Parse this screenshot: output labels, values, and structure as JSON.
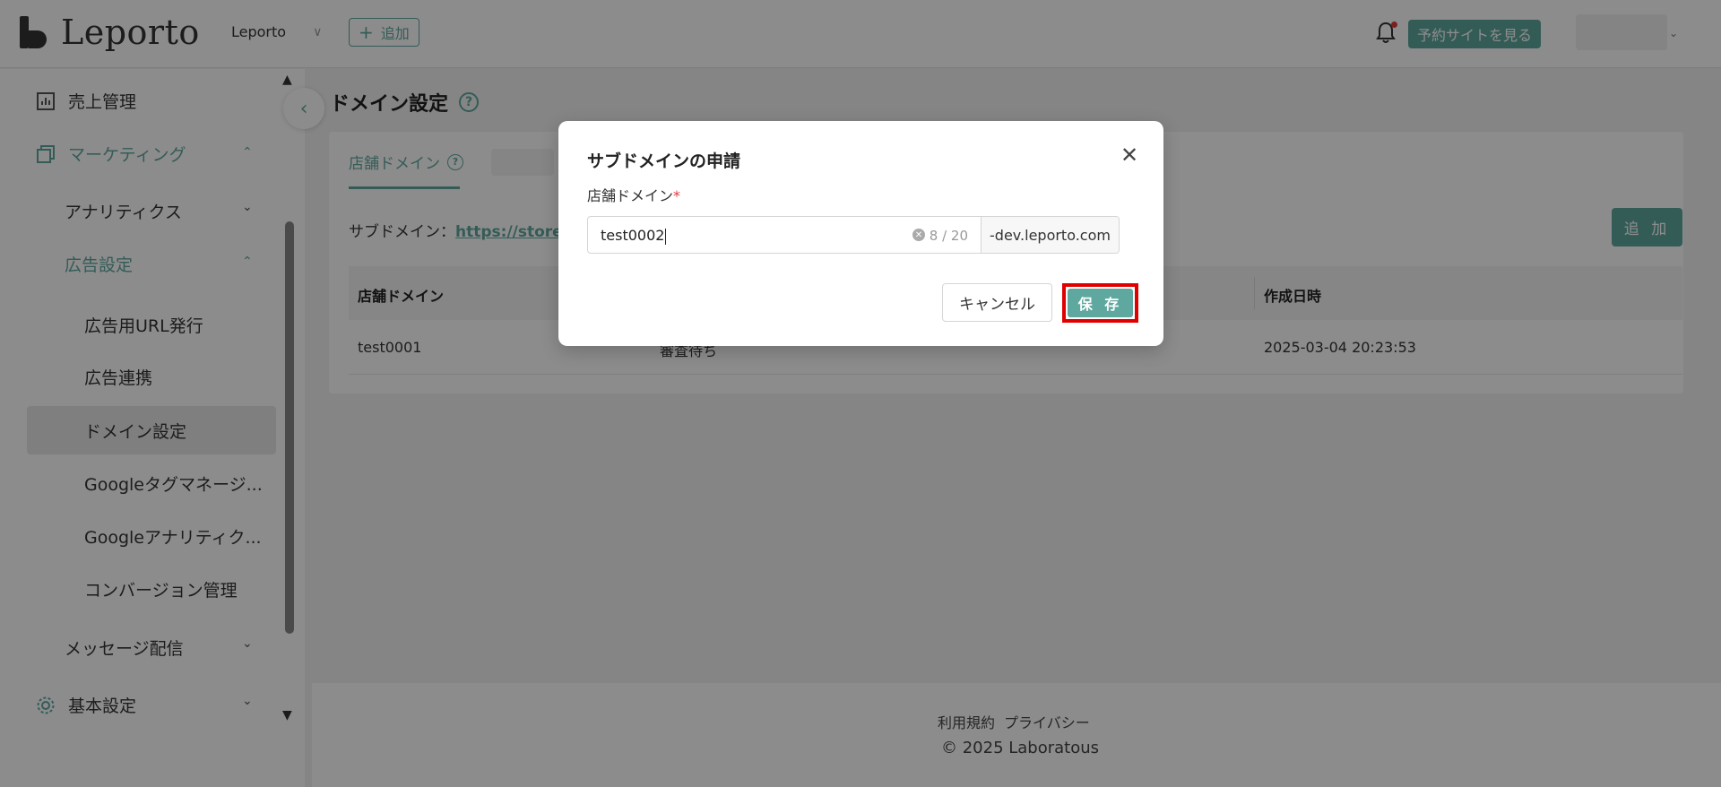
{
  "header": {
    "logo_text": "Leporto",
    "store_name": "Leporto",
    "add_label": "追加",
    "view_site_label": "予約サイトを見る"
  },
  "sidebar": {
    "items": [
      {
        "label": "売上管理"
      },
      {
        "label": "マーケティング"
      },
      {
        "label": "アナリティクス"
      },
      {
        "label": "広告設定"
      },
      {
        "label": "広告用URL発行"
      },
      {
        "label": "広告連携"
      },
      {
        "label": "ドメイン設定"
      },
      {
        "label": "Googleタグマネージ..."
      },
      {
        "label": "Googleアナリティク..."
      },
      {
        "label": "コンバージョン管理"
      },
      {
        "label": "メッセージ配信"
      },
      {
        "label": "基本設定"
      }
    ]
  },
  "main": {
    "page_title": "ドメイン設定",
    "tabs": [
      {
        "label": "店舗ドメイン"
      }
    ],
    "subdomain_label": "サブドメイン：",
    "subdomain_link": "https://store51-c",
    "add_label": "追 加",
    "table": {
      "columns": [
        "店舗ドメイン",
        "作成日時"
      ],
      "rows": [
        {
          "domain": "test0001",
          "status": "審査待ち",
          "created": "2025-03-04 20:23:53"
        }
      ]
    }
  },
  "footer": {
    "links": [
      "利用規約",
      "プライバシー"
    ],
    "copyright": "© 2025 Laboratous"
  },
  "modal": {
    "title": "サブドメインの申請",
    "field_label": "店舗ドメイン",
    "required_mark": "*",
    "input_value": "test0002",
    "count": "8 / 20",
    "suffix": "-dev.leporto.com",
    "cancel_label": "キャンセル",
    "save_label": "保 存"
  },
  "colors": {
    "accent": "#5fa89f",
    "highlight": "#e00000"
  }
}
